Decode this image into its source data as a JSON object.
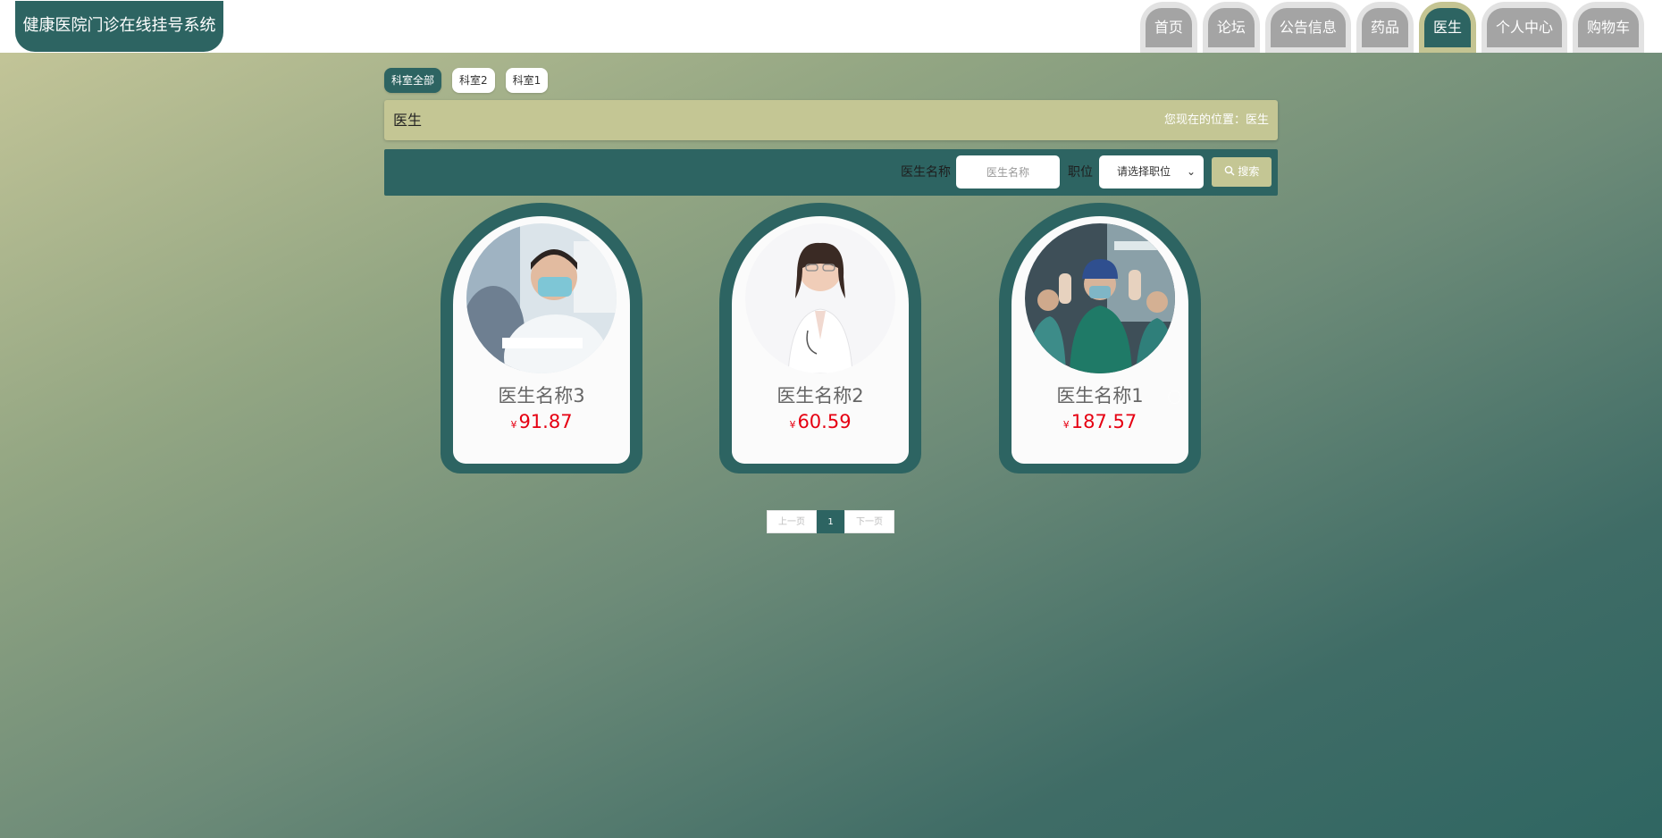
{
  "brand": {
    "title": "健康医院门诊在线挂号系统"
  },
  "nav": {
    "items": [
      {
        "label": "首页"
      },
      {
        "label": "论坛"
      },
      {
        "label": "公告信息"
      },
      {
        "label": "药品"
      },
      {
        "label": "医生",
        "active": true
      },
      {
        "label": "个人中心"
      },
      {
        "label": "购物车"
      }
    ]
  },
  "categories": [
    {
      "label": "科室全部",
      "active": true
    },
    {
      "label": "科室2"
    },
    {
      "label": "科室1"
    }
  ],
  "breadcrumb": {
    "title": "医生",
    "position": "您现在的位置：医生"
  },
  "search": {
    "name_label": "医生名称",
    "name_placeholder": "医生名称",
    "title_label": "职位",
    "title_select": "请选择职位",
    "button_label": "搜索"
  },
  "doctors": [
    {
      "name": "医生名称3",
      "currency": "¥",
      "price": "91.87"
    },
    {
      "name": "医生名称2",
      "currency": "¥",
      "price": "60.59"
    },
    {
      "name": "医生名称1",
      "currency": "¥",
      "price": "187.57"
    }
  ],
  "pagination": {
    "prev": "上一页",
    "current": "1",
    "next": "下一页"
  },
  "colors": {
    "primary": "#2d6462",
    "accent": "#c4c694",
    "price": "#e60012"
  }
}
